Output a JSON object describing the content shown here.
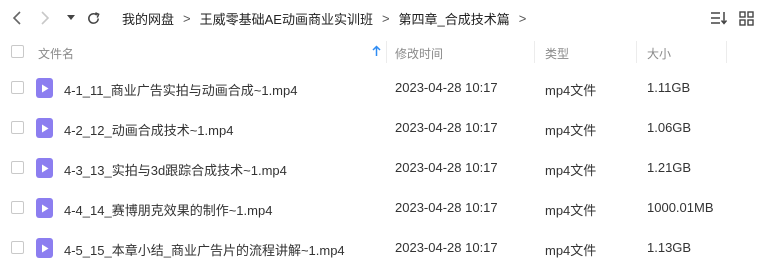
{
  "toolbar": {
    "back_icon": "chevron-left-icon",
    "forward_icon": "chevron-right-icon",
    "dropdown_icon": "caret-down-icon",
    "refresh_icon": "refresh-icon",
    "sort_icon": "sort-toggle-icon",
    "grid_icon": "grid-view-icon"
  },
  "breadcrumb": {
    "items": [
      "我的网盘",
      "王威零基础AE动画商业实训班",
      "第四章_合成技术篇"
    ],
    "separator": ">"
  },
  "table": {
    "columns": {
      "name": "文件名",
      "modified": "修改时间",
      "type": "类型",
      "size": "大小"
    },
    "sort_color": "#2f8cf3",
    "rows": [
      {
        "name": "4-1_11_商业广告实拍与动画合成~1.mp4",
        "modified": "2023-04-28 10:17",
        "type": "mp4文件",
        "size": "1.11GB"
      },
      {
        "name": "4-2_12_动画合成技术~1.mp4",
        "modified": "2023-04-28 10:17",
        "type": "mp4文件",
        "size": "1.06GB"
      },
      {
        "name": "4-3_13_实拍与3d跟踪合成技术~1.mp4",
        "modified": "2023-04-28 10:17",
        "type": "mp4文件",
        "size": "1.21GB"
      },
      {
        "name": "4-4_14_赛博朋克效果的制作~1.mp4",
        "modified": "2023-04-28 10:17",
        "type": "mp4文件",
        "size": "1000.01MB"
      },
      {
        "name": "4-5_15_本章小结_商业广告片的流程讲解~1.mp4",
        "modified": "2023-04-28 10:17",
        "type": "mp4文件",
        "size": "1.13GB"
      }
    ],
    "file_icon": "video-file-icon",
    "file_icon_color": "#8c7ef0"
  }
}
